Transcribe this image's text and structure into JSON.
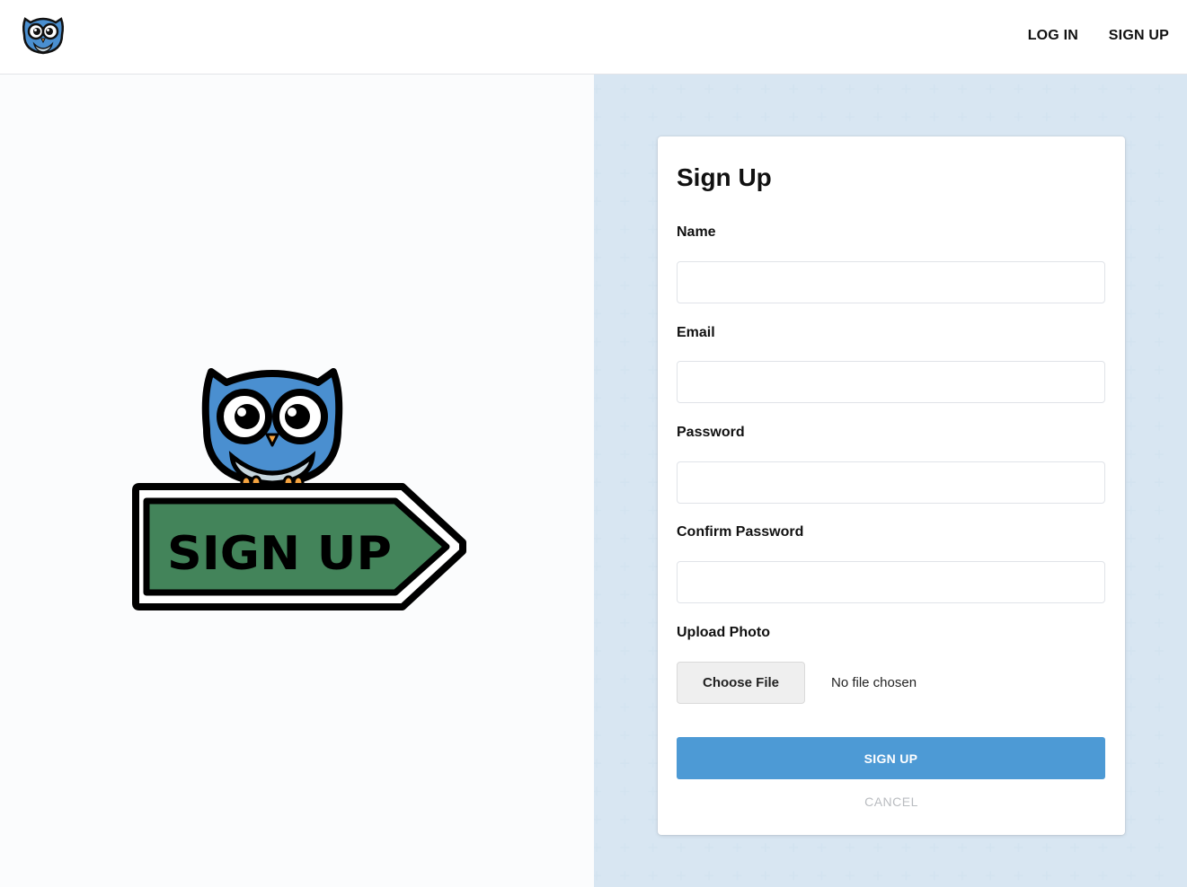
{
  "header": {
    "logo_icon": "owl-logo-icon",
    "nav": {
      "login_label": "LOG IN",
      "signup_label": "SIGN UP"
    }
  },
  "hero": {
    "icon": "owl-sign-up-illustration",
    "sign_text": "SIGN UP",
    "colors": {
      "owl_blue": "#4a8fd0",
      "sign_green": "#43845a"
    }
  },
  "form": {
    "title": "Sign Up",
    "fields": {
      "name": {
        "label": "Name",
        "value": ""
      },
      "email": {
        "label": "Email",
        "value": ""
      },
      "password": {
        "label": "Password",
        "value": ""
      },
      "confirm_password": {
        "label": "Confirm Password",
        "value": ""
      }
    },
    "upload": {
      "label": "Upload Photo",
      "button_label": "Choose File",
      "status": "No file chosen"
    },
    "submit_label": "SIGN UP",
    "cancel_label": "CANCEL",
    "accent_color": "#4d9ad5"
  }
}
